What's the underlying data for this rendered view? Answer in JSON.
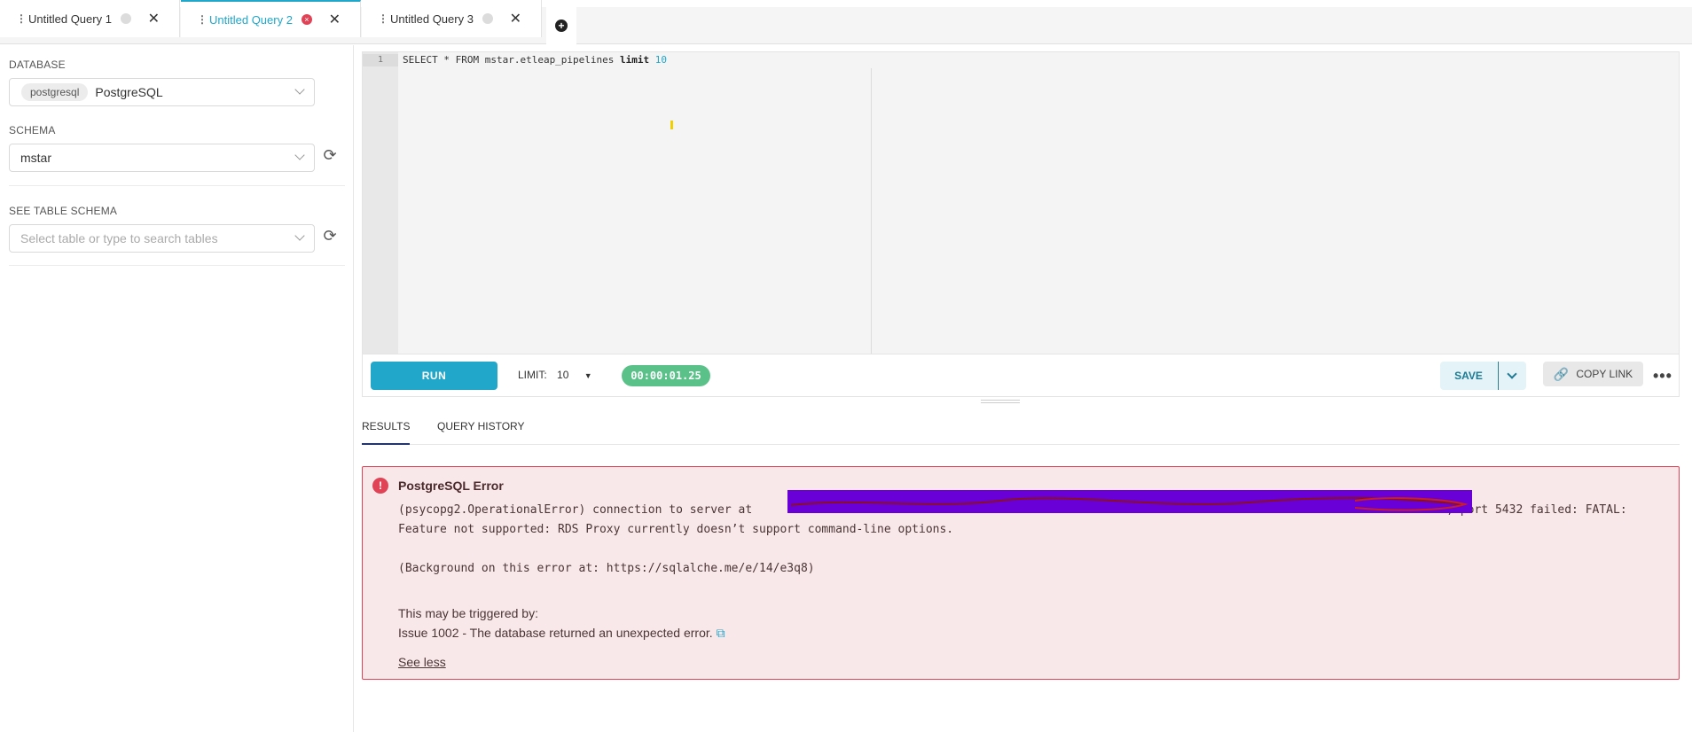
{
  "tabs": [
    {
      "label": "Untitled Query 1",
      "status": "idle"
    },
    {
      "label": "Untitled Query 2",
      "status": "error"
    },
    {
      "label": "Untitled Query 3",
      "status": "idle"
    }
  ],
  "sidebar": {
    "database_label": "DATABASE",
    "database_pill": "postgresql",
    "database_value": "PostgreSQL",
    "schema_label": "SCHEMA",
    "schema_value": "mstar",
    "table_schema_label": "SEE TABLE SCHEMA",
    "table_placeholder": "Select table or type to search tables"
  },
  "editor": {
    "line_number": "1",
    "query_select": "SELECT * FROM mstar.etleap_pipelines ",
    "query_limit_kw": "limit",
    "query_limit_value": "10"
  },
  "toolbar": {
    "run_label": "RUN",
    "limit_label": "LIMIT:",
    "limit_value": "10",
    "timer": "00:00:01.25",
    "save_label": "SAVE",
    "copy_link_label": "COPY LINK",
    "more": "•••"
  },
  "results": {
    "tab_results": "RESULTS",
    "tab_history": "QUERY HISTORY"
  },
  "error": {
    "title": "PostgreSQL Error",
    "line1_a": "(psycopg2.OperationalError) connection to server at",
    "line1_b": ", port 5432 failed: FATAL:",
    "line2": "Feature not supported: RDS Proxy currently doesn’t support command-line options.",
    "line3": "(Background on this error at: https://sqlalche.me/e/14/e3q8)",
    "triggered": "This may be triggered by:",
    "issue": "Issue 1002 - The database returned an unexpected error.",
    "see_less": "See less"
  },
  "colors": {
    "accent": "#20a7c9",
    "error": "#e04355",
    "success": "#5ac189",
    "redaction": "#6a00d8"
  }
}
